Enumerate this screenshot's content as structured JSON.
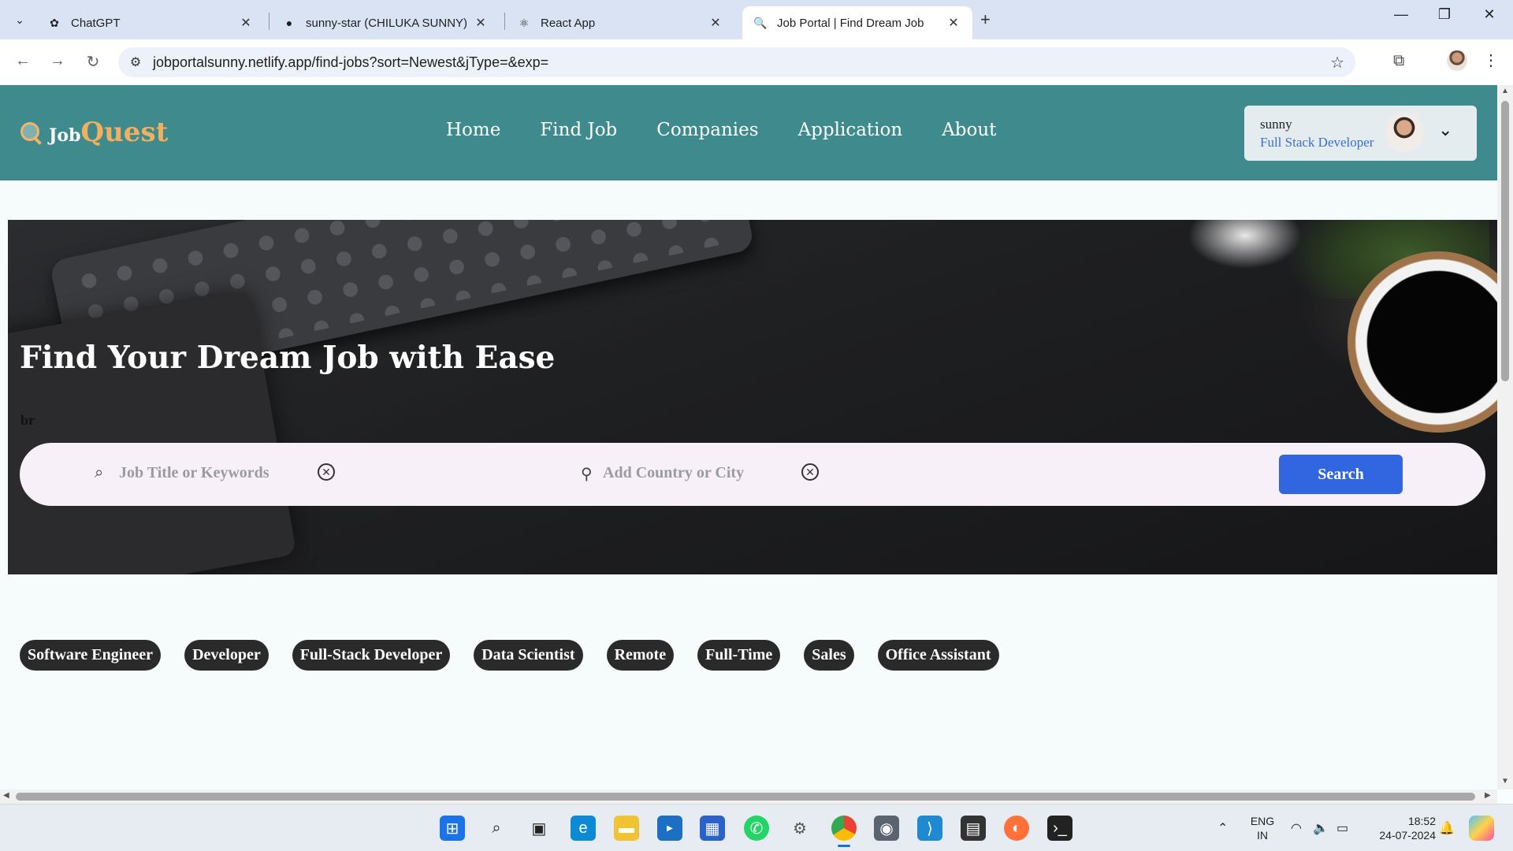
{
  "browser": {
    "tabs": [
      {
        "title": "ChatGPT",
        "icon": "chatgpt-icon"
      },
      {
        "title": "sunny-star (CHILUKA SUNNY)",
        "icon": "github-icon"
      },
      {
        "title": "React App",
        "icon": "react-icon"
      },
      {
        "title": "Job Portal | Find Dream Job",
        "icon": "jobquest-icon",
        "active": true
      }
    ],
    "url": "jobportalsunny.netlify.app/find-jobs?sort=Newest&jType=&exp="
  },
  "site": {
    "logo": {
      "part1": "Job",
      "part2": "Quest"
    },
    "nav": [
      "Home",
      "Find Job",
      "Companies",
      "Application",
      "About"
    ],
    "user": {
      "name": "sunny",
      "role": "Full Stack Developer"
    }
  },
  "hero": {
    "title": "Find Your Dream Job with Ease",
    "br_text": "br",
    "search": {
      "keyword_placeholder": "Job Title or Keywords",
      "location_placeholder": "Add Country or City",
      "button": "Search"
    }
  },
  "tags": [
    "Software Engineer",
    "Developer",
    "Full-Stack Developer",
    "Data Scientist",
    "Remote",
    "Full-Time",
    "Sales",
    "Office Assistant"
  ],
  "taskbar": {
    "lang1": "ENG",
    "lang2": "IN",
    "time": "18:52",
    "date": "24-07-2024"
  },
  "colors": {
    "navbar": "#3f8a8c",
    "accent": "#f0b060",
    "search_button": "#3266e0",
    "tag_bg": "#2a2a2a"
  }
}
